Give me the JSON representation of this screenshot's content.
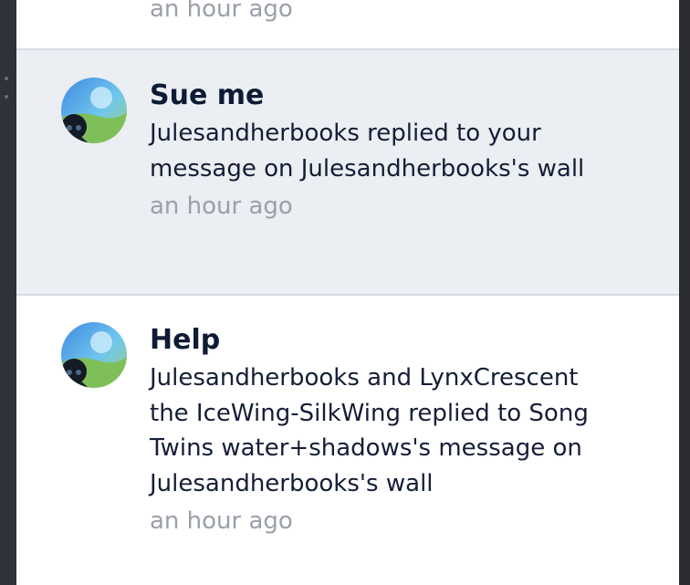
{
  "notifications": [
    {
      "timestamp": "an hour ago"
    },
    {
      "title": "Sue me",
      "message": "Julesandherbooks replied to your message on Julesandherbooks's wall",
      "timestamp": "an hour ago",
      "unread": true
    },
    {
      "title": "Help",
      "message": "Julesandherbooks and LynxCrescent the IceWing-SilkWing replied to Song Twins water+shadows's message on Julesandherbooks's wall",
      "timestamp": "an hour ago",
      "unread": false
    }
  ],
  "colors": {
    "unread_background": "#ebeef2",
    "read_background": "#ffffff",
    "title_text": "#0e1b35",
    "timestamp_text": "#9aa0a8",
    "divider": "#d5dae2"
  }
}
